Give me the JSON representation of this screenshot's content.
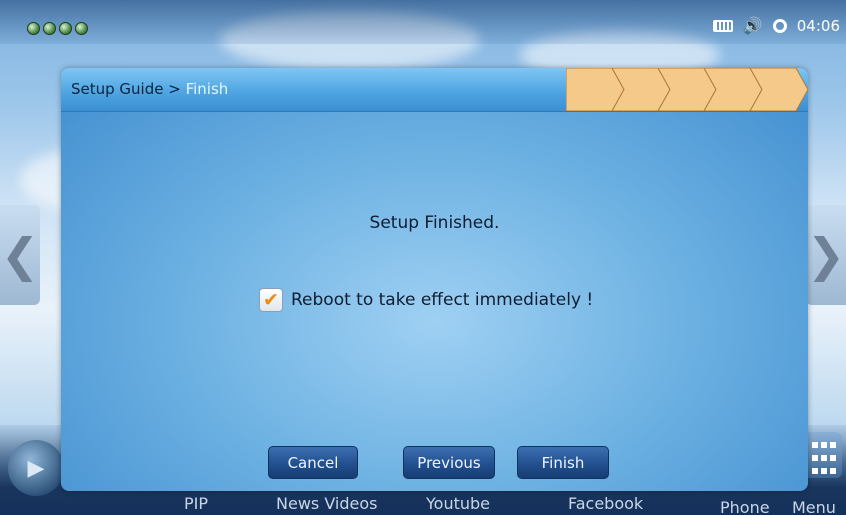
{
  "status_bar": {
    "time": "04:06",
    "icons": [
      "keyboard-icon",
      "volume-icon",
      "sync-icon"
    ],
    "indicator_dots": 4
  },
  "dialog": {
    "breadcrumb_root": "Setup Guide >",
    "breadcrumb_current": "Finish",
    "step_count": 5,
    "message": "Setup Finished.",
    "reboot_checkbox": {
      "label": "Reboot to take effect immediately !",
      "checked": true
    },
    "buttons": {
      "cancel": "Cancel",
      "previous": "Previous",
      "finish": "Finish"
    }
  },
  "dock": {
    "items": [
      "PIP",
      "News Videos",
      "Youtube",
      "Facebook",
      "Phone",
      "Menu"
    ]
  },
  "colors": {
    "step_fill": "#f5c98a",
    "check_color": "#f08a12",
    "button_color": "#22508f"
  }
}
